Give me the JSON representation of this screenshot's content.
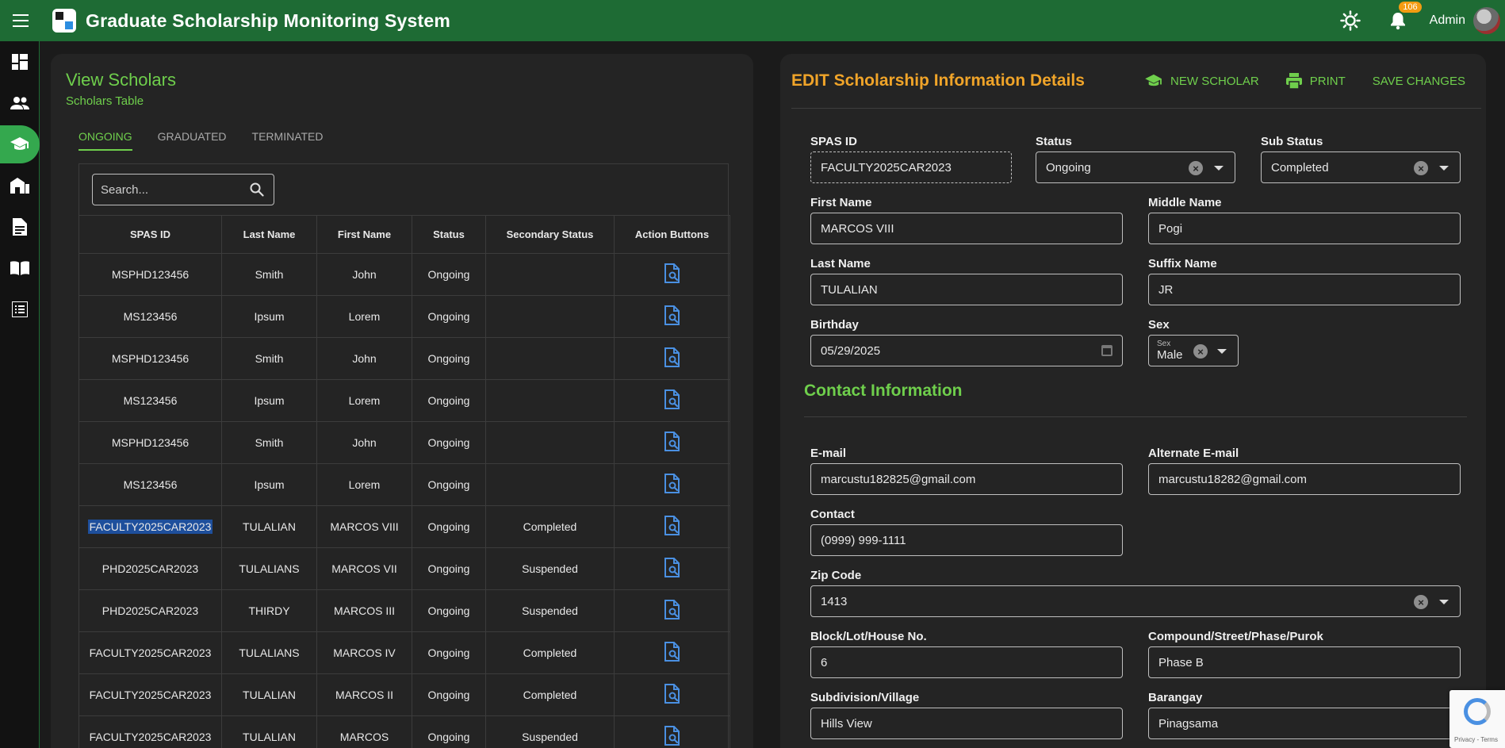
{
  "app": {
    "title": "Graduate Scholarship Monitoring System",
    "notif_count": "106",
    "user": "Admin"
  },
  "sidebar": {
    "items": [
      {
        "icon": "dashboard-icon"
      },
      {
        "icon": "users-icon"
      },
      {
        "icon": "graduation-cap-icon",
        "active": true
      },
      {
        "icon": "school-building-icon"
      },
      {
        "icon": "document-icon"
      },
      {
        "icon": "book-icon"
      },
      {
        "icon": "list-icon"
      }
    ]
  },
  "left": {
    "title": "View Scholars",
    "subtitle": "Scholars Table",
    "tabs": [
      "ONGOING",
      "GRADUATED",
      "TERMINATED"
    ],
    "search_placeholder": "Search...",
    "columns": [
      "SPAS ID",
      "Last Name",
      "First Name",
      "Status",
      "Secondary Status",
      "Action Buttons"
    ],
    "rows": [
      [
        "MSPHD123456",
        "Smith",
        "John",
        "Ongoing",
        ""
      ],
      [
        "MS123456",
        "Ipsum",
        "Lorem",
        "Ongoing",
        ""
      ],
      [
        "MSPHD123456",
        "Smith",
        "John",
        "Ongoing",
        ""
      ],
      [
        "MS123456",
        "Ipsum",
        "Lorem",
        "Ongoing",
        ""
      ],
      [
        "MSPHD123456",
        "Smith",
        "John",
        "Ongoing",
        ""
      ],
      [
        "MS123456",
        "Ipsum",
        "Lorem",
        "Ongoing",
        ""
      ],
      [
        "FACULTY2025CAR2023",
        "TULALIAN",
        "MARCOS VIII",
        "Ongoing",
        "Completed"
      ],
      [
        "PHD2025CAR2023",
        "TULALIANS",
        "MARCOS VII",
        "Ongoing",
        "Suspended"
      ],
      [
        "PHD2025CAR2023",
        "THIRDY",
        "MARCOS III",
        "Ongoing",
        "Suspended"
      ],
      [
        "FACULTY2025CAR2023",
        "TULALIANS",
        "MARCOS IV",
        "Ongoing",
        "Completed"
      ],
      [
        "FACULTY2025CAR2023",
        "TULALIAN",
        "MARCOS II",
        "Ongoing",
        "Completed"
      ],
      [
        "FACULTY2025CAR2023",
        "TULALIAN",
        "MARCOS",
        "Ongoing",
        "Suspended"
      ]
    ]
  },
  "right": {
    "title": "EDIT Scholarship Information Details",
    "actions": {
      "new": "NEW SCHOLAR",
      "print": "PRINT",
      "save": "SAVE CHANGES"
    },
    "fields": {
      "spas_id": {
        "label": "SPAS ID",
        "value": "FACULTY2025CAR2023"
      },
      "status": {
        "label": "Status",
        "value": "Ongoing"
      },
      "sub_status": {
        "label": "Sub Status",
        "value": "Completed"
      },
      "first_name": {
        "label": "First Name",
        "value": "MARCOS VIII"
      },
      "middle_name": {
        "label": "Middle Name",
        "value": "Pogi"
      },
      "last_name": {
        "label": "Last Name",
        "value": "TULALIAN"
      },
      "suffix_name": {
        "label": "Suffix Name",
        "value": "JR"
      },
      "birthday": {
        "label": "Birthday",
        "value": "05/29/2025"
      },
      "sex": {
        "label": "Sex",
        "inner_label": "Sex",
        "value": "Male"
      },
      "email": {
        "label": "E-mail",
        "value": "marcustu182825@gmail.com"
      },
      "alt_email": {
        "label": "Alternate E-mail",
        "value": "marcustu18282@gmail.com"
      },
      "contact": {
        "label": "Contact",
        "value": "(0999) 999-1111"
      },
      "zip": {
        "label": "Zip Code",
        "value": "1413"
      },
      "block": {
        "label": "Block/Lot/House No.",
        "value": "6"
      },
      "street": {
        "label": "Compound/Street/Phase/Purok",
        "value": "Phase B"
      },
      "subdivision": {
        "label": "Subdivision/Village",
        "value": "Hills View"
      },
      "barangay": {
        "label": "Barangay",
        "value": "Pinagsama"
      }
    },
    "contact_section": "Contact Information"
  },
  "recaptcha": {
    "text": "Privacy - Terms"
  },
  "colors": {
    "header": "#1e6b34",
    "accent_green": "#6fcf4c",
    "accent_orange": "#f0a429",
    "icon_blue": "#4a90e2"
  }
}
